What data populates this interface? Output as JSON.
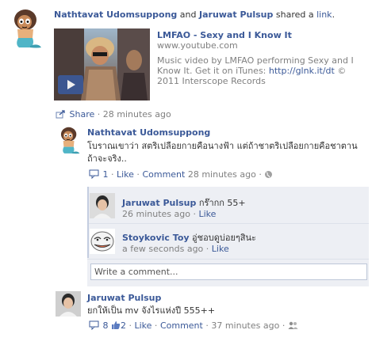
{
  "story": {
    "actor1": "Nathtavat Udomsuppong",
    "connector": " and ",
    "actor2": "Jaruwat Pulsup",
    "verb": " shared a ",
    "object": "link",
    "period": "."
  },
  "attachment": {
    "title": "LMFAO - Sexy and I Know It",
    "domain": "www.youtube.com",
    "desc_part1": "Music video by LMFAO performing Sexy and I Know It. Get it on iTunes: ",
    "desc_link": "http://glnk.it/dt",
    "desc_part2": " © 2011 Interscope Records"
  },
  "story_actions": {
    "share": "Share",
    "separator": " · ",
    "time": "28 minutes ago"
  },
  "comments": [
    {
      "author": "Nathtavat Udomsuppong",
      "text": "โบราณเขาว่า สตริเปลือยกายคือนางฟ้า แต่ถ้าชาตริเปลือยกายคือชาตาน ถ้าจะจริง..",
      "reply_count": "1",
      "like": "Like",
      "comment": "Comment",
      "time": "28 minutes ago"
    },
    {
      "author": "Jaruwat Pulsup",
      "text": "ยกให้เป็น mv จังไรแห่งปี 555++",
      "reply_count": "8",
      "like_count": "2",
      "like": "Like",
      "comment": "Comment",
      "time": "37 minutes ago"
    }
  ],
  "replies": [
    {
      "author": "Jaruwat Pulsup",
      "text": "กร๊ากก 55+",
      "time": "26 minutes ago",
      "like": "Like"
    },
    {
      "author": "Stoykovic Toy",
      "text": "อู่ชอบดูบ่อยๆสินะ",
      "time": "a few seconds ago",
      "like": "Like"
    }
  ],
  "write_comment": {
    "placeholder": "Write a comment..."
  },
  "colors": {
    "link": "#3b5998",
    "meta": "#808080",
    "panel": "#edeff4",
    "accent": "#5b9bd5"
  }
}
